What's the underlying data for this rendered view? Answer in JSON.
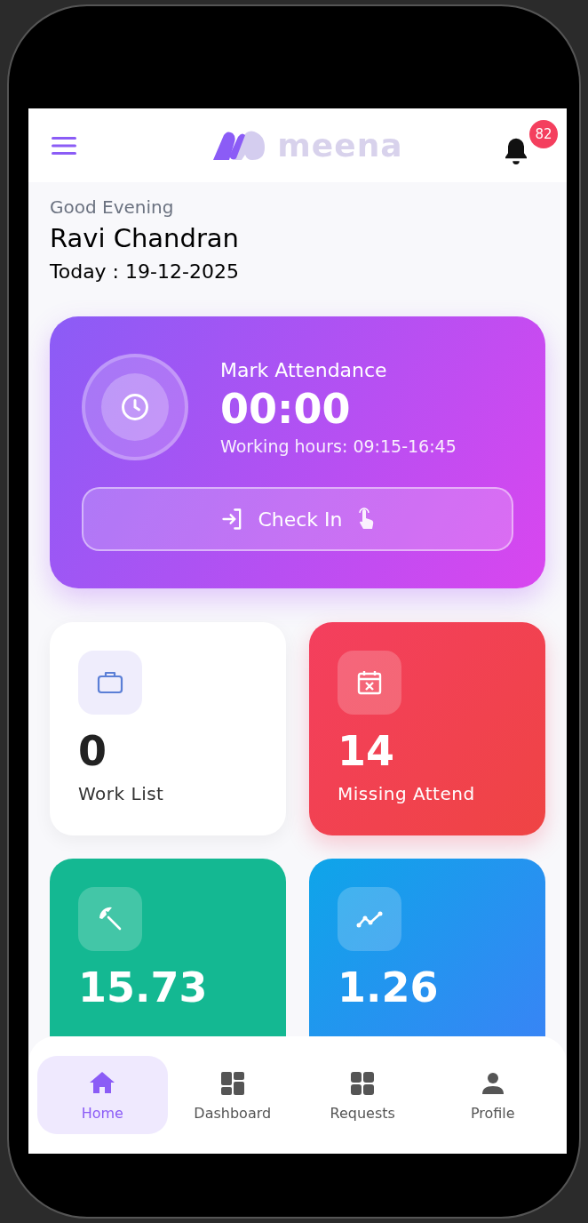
{
  "header": {
    "logo_text": "meena",
    "notification_count": "82"
  },
  "greeting": {
    "salutation": "Good Evening",
    "name": "Ravi Chandran",
    "date_line": "Today : 19-12-2025"
  },
  "attendance": {
    "title": "Mark Attendance",
    "timer": "00:00",
    "working_hours": "Working hours: 09:15-16:45",
    "button": "Check In"
  },
  "stats": [
    {
      "kind": "work",
      "value": "0",
      "label": "Work List"
    },
    {
      "kind": "missing",
      "value": "14",
      "label": "Missing Attend"
    },
    {
      "kind": "leave",
      "value": "15.73"
    },
    {
      "kind": "service",
      "value": "1.26"
    }
  ],
  "bottom_nav": [
    {
      "kind": "home",
      "label": "Home",
      "selected": true
    },
    {
      "kind": "dashboard",
      "label": "Dashboard",
      "selected": false
    },
    {
      "kind": "requests",
      "label": "Requests",
      "selected": false
    },
    {
      "kind": "profile",
      "label": "Profile",
      "selected": false
    }
  ]
}
